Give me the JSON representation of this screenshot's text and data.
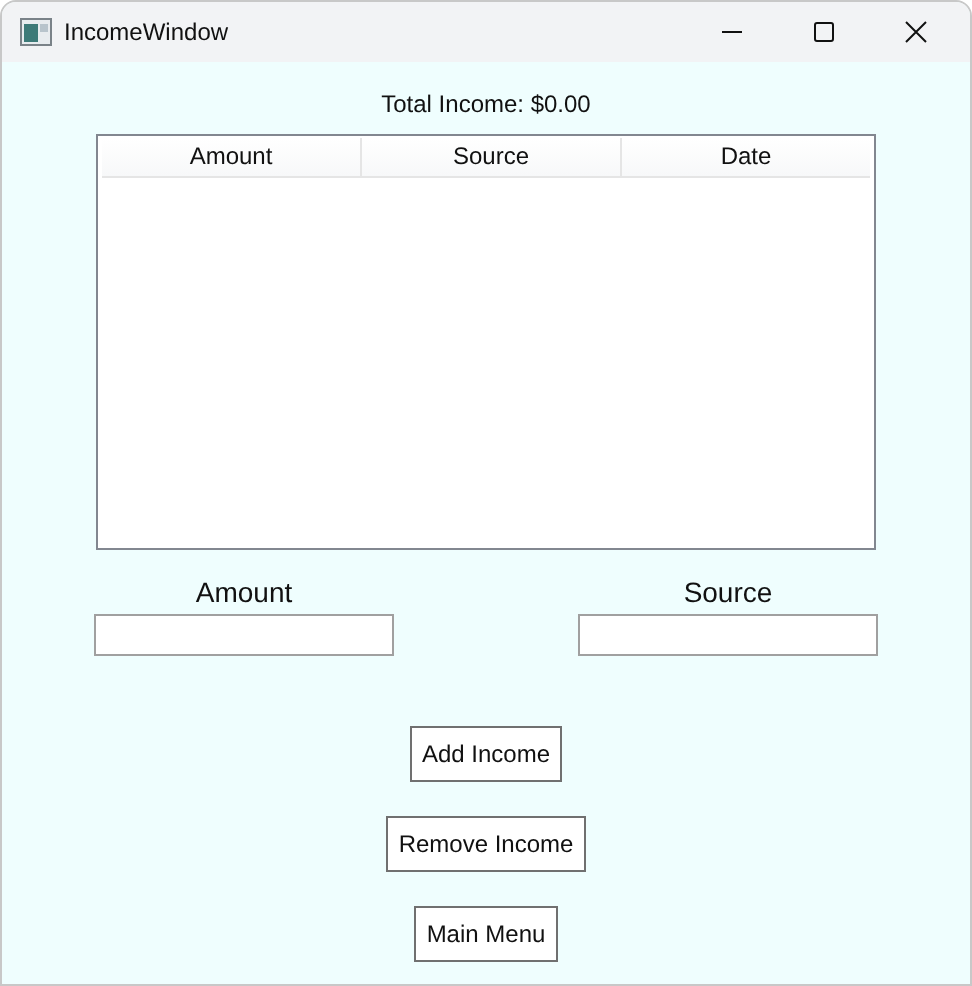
{
  "window": {
    "title": "IncomeWindow"
  },
  "total": "Total Income: $0.00",
  "table": {
    "columns": [
      "Amount",
      "Source",
      "Date"
    ]
  },
  "fields": [
    {
      "label": "Amount"
    },
    {
      "label": "Source"
    }
  ],
  "buttons": [
    "Add Income",
    "Remove Income",
    "Main Menu"
  ]
}
